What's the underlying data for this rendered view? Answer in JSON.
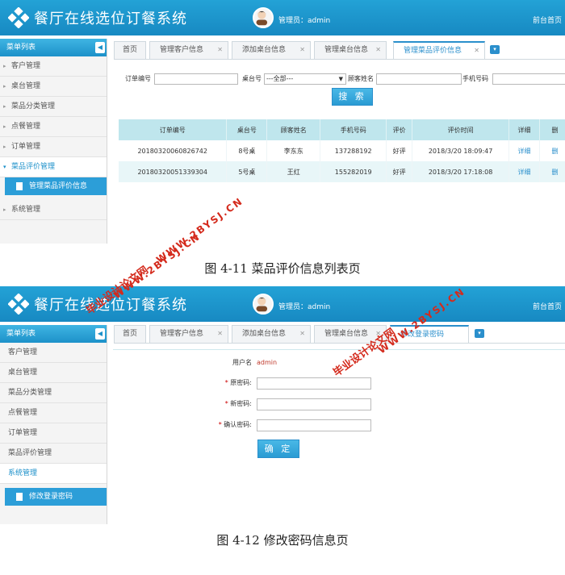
{
  "app": {
    "title": "餐厅在线选位订餐系统",
    "admin_label": "管理员：admin",
    "home_link": "前台首页"
  },
  "sidebar": {
    "header": "菜单列表",
    "items": [
      "客户管理",
      "桌台管理",
      "菜品分类管理",
      "点餐管理",
      "订单管理",
      "菜品评价管理",
      "系统管理"
    ]
  },
  "screen1": {
    "open_menu": "菜品评价管理",
    "sub_item": "管理菜品评价信息",
    "tabs": [
      "首页",
      "管理客户信息",
      "添加桌台信息",
      "管理桌台信息",
      "管理菜品评价信息"
    ],
    "filter": {
      "order_no_label": "订单编号",
      "table_no_label": "桌台号",
      "table_select_value": "---全部---",
      "customer_label": "顾客姓名",
      "phone_label": "手机号码",
      "search_button": "搜 索"
    },
    "table": {
      "headers": [
        "订单编号",
        "桌台号",
        "顾客姓名",
        "手机号码",
        "评价",
        "评价时间",
        "详细",
        "删"
      ],
      "rows": [
        [
          "20180320060826742",
          "8号桌",
          "李东东",
          "137288192",
          "好评",
          "2018/3/20 18:09:47",
          "详细",
          "删"
        ],
        [
          "20180320051339304",
          "5号桌",
          "王红",
          "155282019",
          "好评",
          "2018/3/20 17:18:08",
          "详细",
          "删"
        ]
      ]
    },
    "caption": "图 4-11 菜品评价信息列表页"
  },
  "screen2": {
    "open_menu": "系统管理",
    "sub_item": "修改登录密码",
    "tabs": [
      "首页",
      "管理客户信息",
      "添加桌台信息",
      "管理桌台信息",
      "修改登录密码"
    ],
    "form": {
      "username_label": "用户名",
      "username_value": "admin",
      "old_pw_label": "原密码:",
      "new_pw_label": "新密码:",
      "confirm_pw_label": "确认密码:",
      "required_mark": "*",
      "submit_button": "确 定"
    },
    "caption": "图 4-12 修改密码信息页"
  },
  "watermark": {
    "cn": "毕业设计论文网",
    "en": "WWW.2BYSJ.CN"
  },
  "colors": {
    "topbar": "#1789c2",
    "accent": "#2a8fcc",
    "table_header": "#bfe6ed",
    "watermark": "#d42a1c"
  }
}
